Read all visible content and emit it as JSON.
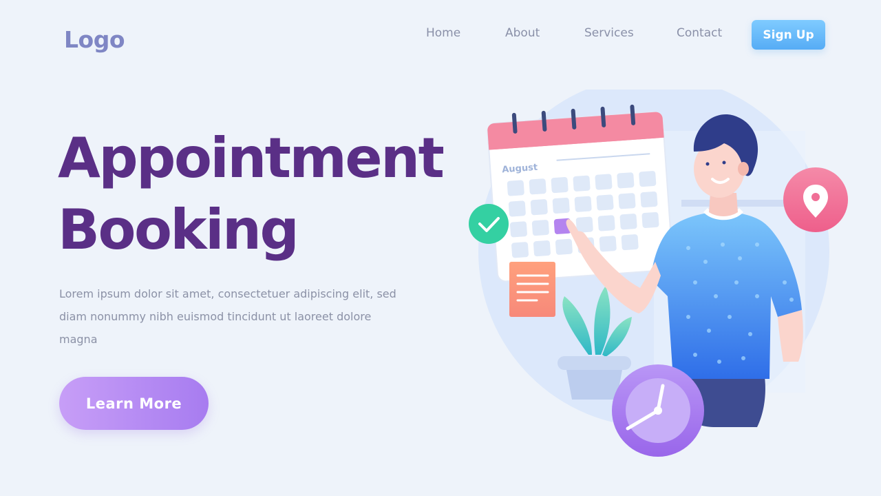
{
  "header": {
    "logo": "Logo",
    "nav": [
      {
        "label": "Home"
      },
      {
        "label": "About"
      },
      {
        "label": "Services"
      },
      {
        "label": "Contact"
      }
    ],
    "signup_label": "Sign Up"
  },
  "hero": {
    "title_line1": "Appointment",
    "title_line2": "Booking",
    "description": "Lorem ipsum dolor sit amet, consectetuer adipiscing elit, sed diam nonummy nibh euismod tincidunt ut laoreet dolore magna",
    "cta_label": "Learn More"
  },
  "illustration": {
    "calendar_month": "August",
    "icons": [
      "calendar-icon",
      "check-icon",
      "location-pin-icon",
      "clock-icon",
      "note-icon",
      "plant-icon",
      "person-illustration"
    ]
  },
  "colors": {
    "background": "#eef3fa",
    "title": "#5a2f86",
    "logo": "#7f86c4",
    "signup": "#5fb3f6",
    "cta": "#b48af3",
    "calendar_header": "#f48aa2",
    "shirt": "#4d95ee",
    "pin_badge": "#f06f96",
    "check_badge": "#34d0a2",
    "clock": "#a87ef0"
  }
}
